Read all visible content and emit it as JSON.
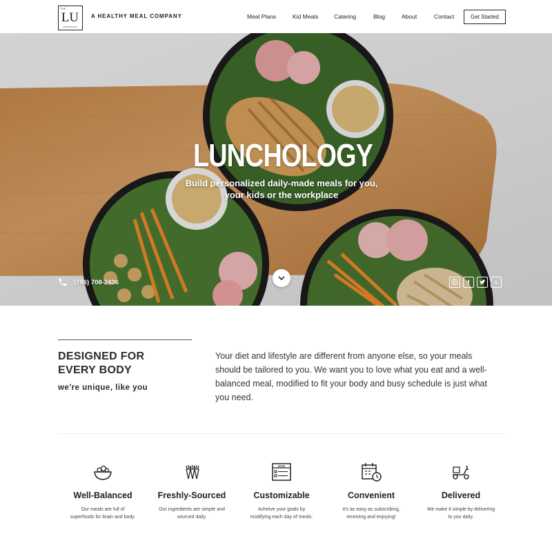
{
  "header": {
    "logo": {
      "letters": "LU",
      "tiny": "THE",
      "sub": "LUNCHOLOGY"
    },
    "tagline": "A HEALTHY MEAL COMPANY",
    "nav": [
      "Meal Plans",
      "Kid Meals",
      "Catering",
      "Blog",
      "About",
      "Contact"
    ],
    "cta_label": "Get Started"
  },
  "hero": {
    "title": "LUNCHOLOGY",
    "subtitle_line1": "Build personalized daily-made meals for you,",
    "subtitle_line2": "your kids or the workplace",
    "phone": "(786) 708-2436",
    "socials": [
      "instagram-icon",
      "facebook-icon",
      "twitter-icon",
      "yelp-icon"
    ]
  },
  "intro": {
    "heading_line1": "DESIGNED FOR",
    "heading_line2": "EVERY BODY",
    "tagline": "we're unique, like you",
    "paragraph": "Your diet and lifestyle are different from anyone else, so your meals should be tailored to you. We want you to love what you eat and a well-balanced meal, modified to fit your body and busy schedule is just what you need."
  },
  "features": [
    {
      "icon": "salad-bowl-icon",
      "title": "Well-Balanced",
      "desc_line1": "Our meals are full of",
      "desc_line2": "superfoods for brain and body."
    },
    {
      "icon": "carrots-icon",
      "title": "Freshly-Sourced",
      "desc_line1": "Our ingredients are simple and",
      "desc_line2": "sourced daily."
    },
    {
      "icon": "web-form-icon",
      "title": "Customizable",
      "desc_line1": "Acheive your goals by",
      "desc_line2": "modifying each day of meals."
    },
    {
      "icon": "calendar-clock-icon",
      "title": "Convenient",
      "desc_line1": "It's as easy as subscribing,",
      "desc_line2": "receiving and enjoying!"
    },
    {
      "icon": "delivery-scooter-icon",
      "title": "Delivered",
      "desc_line1": "We make it simple by delivering",
      "desc_line2": "to you daily."
    }
  ],
  "colors": {
    "text": "#2c2c2c",
    "hero_text": "#ffffff",
    "wood": "#c98c50"
  }
}
